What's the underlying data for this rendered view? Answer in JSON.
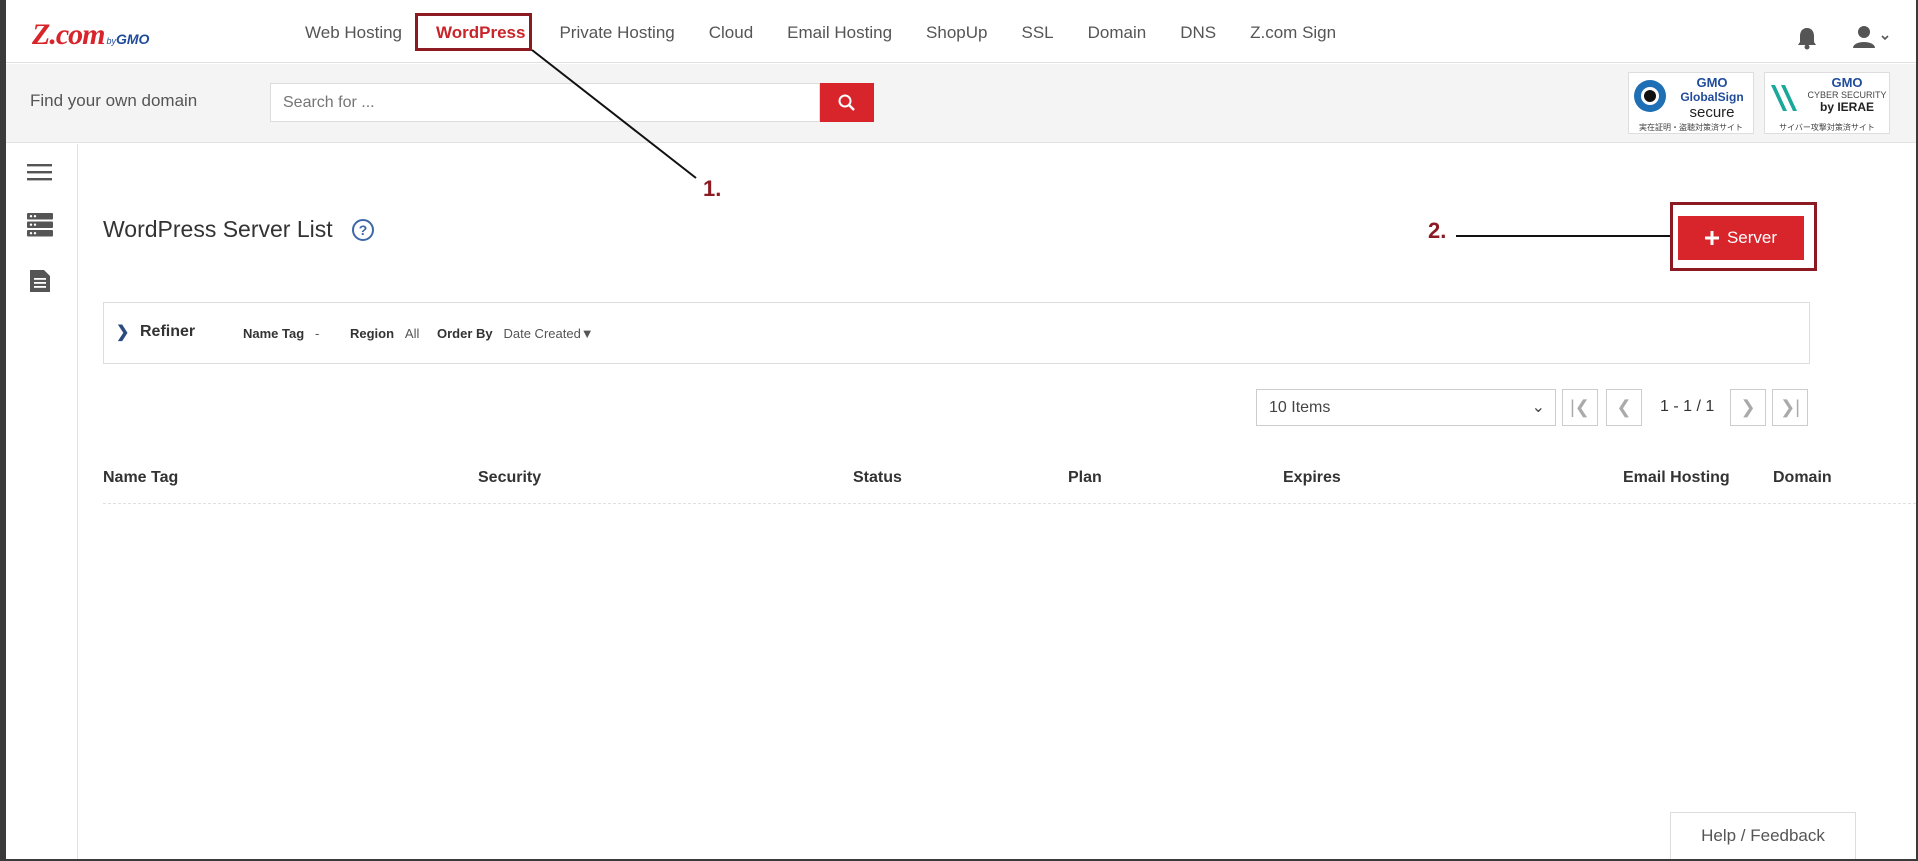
{
  "brand": {
    "logo_text": "Z.com",
    "logo_by": "by",
    "logo_gmo": "GMO"
  },
  "nav": {
    "items": [
      {
        "label": "Web Hosting",
        "active": false
      },
      {
        "label": "WordPress",
        "active": true
      },
      {
        "label": "Private Hosting",
        "active": false
      },
      {
        "label": "Cloud",
        "active": false
      },
      {
        "label": "Email Hosting",
        "active": false
      },
      {
        "label": "ShopUp",
        "active": false
      },
      {
        "label": "SSL",
        "active": false
      },
      {
        "label": "Domain",
        "active": false
      },
      {
        "label": "DNS",
        "active": false
      },
      {
        "label": "Z.com Sign",
        "active": false
      }
    ]
  },
  "search": {
    "label": "Find your own domain",
    "placeholder": "Search for ..."
  },
  "badges": {
    "globalsign": {
      "line1": "GMO",
      "line2": "GlobalSign",
      "line3": "secure",
      "line4": "実在証明・盗聴対策済サイト"
    },
    "ierae": {
      "line1": "GMO",
      "line2": "CYBER SECURITY",
      "line3": "by IERAE",
      "line4": "サイバー攻撃対策済サイト"
    }
  },
  "main": {
    "title": "WordPress Server List",
    "help_glyph": "?",
    "server_button": "Server",
    "annotations": {
      "step1": "1.",
      "step2": "2."
    }
  },
  "refiner": {
    "label": "Refiner",
    "filters": [
      {
        "key": "Name Tag",
        "value": "-"
      },
      {
        "key": "Region",
        "value": "All"
      },
      {
        "key": "Order By",
        "value": "Date Created▼"
      }
    ]
  },
  "pager": {
    "items_per_page": "10 Items",
    "count": "1 - 1 / 1"
  },
  "table": {
    "columns": [
      "Name Tag",
      "Security",
      "Status",
      "Plan",
      "Expires",
      "Email Hosting",
      "Domain"
    ]
  },
  "footer": {
    "feedback": "Help / Feedback"
  },
  "colors": {
    "brand_red": "#d7252b",
    "annotation": "#8b1a22",
    "link_blue": "#1f4b9b"
  }
}
